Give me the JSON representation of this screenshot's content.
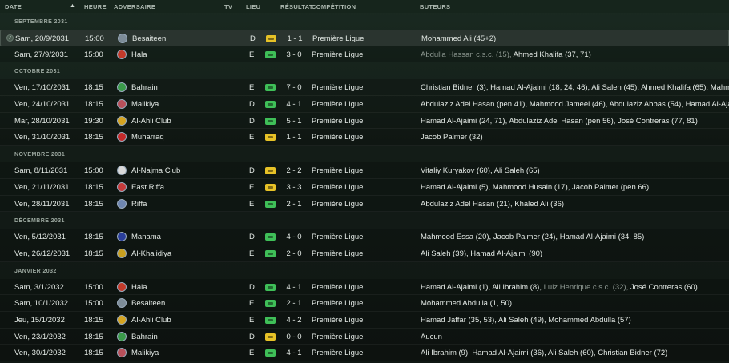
{
  "header": {
    "date": "DATE",
    "time": "HEURE",
    "opponent": "ADVERSAIRE",
    "tv": "TV",
    "venue": "LIEU",
    "result": "RÉSULTAT",
    "competition": "COMPÉTITION",
    "scorers": "BUTEURS"
  },
  "colors": {
    "draw": "#e7c227",
    "win": "#3fbf58"
  },
  "sections": [
    {
      "label": "SEPTEMBRE 2031",
      "matches": [
        {
          "date": "Sam, 20/9/2031",
          "time": "15:00",
          "opponent": "Besaiteen",
          "venue": "D",
          "result_type": "D",
          "score": "1 - 1",
          "competition": "Première Ligue",
          "scorers": [
            {
              "text": "Mohammed Ali (45+2)",
              "muted": false
            }
          ],
          "selected": true
        },
        {
          "date": "Sam, 27/9/2031",
          "time": "15:00",
          "opponent": "Hala",
          "venue": "E",
          "result_type": "V",
          "score": "3 - 0",
          "competition": "Première Ligue",
          "scorers": [
            {
              "text": "Abdulla Hassan c.s.c. (15),",
              "muted": true
            },
            {
              "text": " Ahmed Khalifa (37, 71)",
              "muted": false
            }
          ]
        }
      ]
    },
    {
      "label": "OCTOBRE 2031",
      "matches": [
        {
          "date": "Ven, 17/10/2031",
          "time": "18:15",
          "opponent": "Bahrain",
          "venue": "E",
          "result_type": "V",
          "score": "7 - 0",
          "competition": "Première Ligue",
          "scorers": [
            {
              "text": "Christian Bidner (3), Hamad Al-Ajaimi (18, 24, 46), Ali Saleh (45), Ahmed Khalifa (65), Mahmo",
              "muted": false
            }
          ]
        },
        {
          "date": "Ven, 24/10/2031",
          "time": "18:15",
          "opponent": "Malikiya",
          "venue": "D",
          "result_type": "V",
          "score": "4 - 1",
          "competition": "Première Ligue",
          "scorers": [
            {
              "text": "Abdulaziz Adel Hasan (pen 41), Mahmood Jameel (46), Abdulaziz Abbas (54), Hamad Al-Aja",
              "muted": false
            }
          ]
        },
        {
          "date": "Mar, 28/10/2031",
          "time": "19:30",
          "opponent": "Al-Ahli Club",
          "venue": "D",
          "result_type": "V",
          "score": "5 - 1",
          "competition": "Première Ligue",
          "scorers": [
            {
              "text": "Hamad Al-Ajaimi (24, 71), Abdulaziz Adel Hasan (pen 56), José Contreras (77, 81)",
              "muted": false
            }
          ]
        },
        {
          "date": "Ven, 31/10/2031",
          "time": "18:15",
          "opponent": "Muharraq",
          "venue": "E",
          "result_type": "D",
          "score": "1 - 1",
          "competition": "Première Ligue",
          "scorers": [
            {
              "text": "Jacob Palmer (32)",
              "muted": false
            }
          ]
        }
      ]
    },
    {
      "label": "NOVEMBRE 2031",
      "matches": [
        {
          "date": "Sam, 8/11/2031",
          "time": "15:00",
          "opponent": "Al-Najma Club",
          "venue": "D",
          "result_type": "D",
          "score": "2 - 2",
          "competition": "Première Ligue",
          "scorers": [
            {
              "text": "Vitaliy Kuryakov (60), Ali Saleh (65)",
              "muted": false
            }
          ]
        },
        {
          "date": "Ven, 21/11/2031",
          "time": "18:15",
          "opponent": "East Riffa",
          "venue": "E",
          "result_type": "D",
          "score": "3 - 3",
          "competition": "Première Ligue",
          "scorers": [
            {
              "text": "Hamad Al-Ajaimi (5), Mahmood Husain (17), Jacob Palmer (pen 66)",
              "muted": false
            }
          ]
        },
        {
          "date": "Ven, 28/11/2031",
          "time": "18:15",
          "opponent": "Riffa",
          "venue": "E",
          "result_type": "V",
          "score": "2 - 1",
          "competition": "Première Ligue",
          "scorers": [
            {
              "text": "Abdulaziz Adel Hasan (21), Khaled Ali (36)",
              "muted": false
            }
          ]
        }
      ]
    },
    {
      "label": "DÉCEMBRE 2031",
      "matches": [
        {
          "date": "Ven, 5/12/2031",
          "time": "18:15",
          "opponent": "Manama",
          "venue": "D",
          "result_type": "V",
          "score": "4 - 0",
          "competition": "Première Ligue",
          "scorers": [
            {
              "text": "Mahmood Essa (20), Jacob Palmer (24), Hamad Al-Ajaimi (34, 85)",
              "muted": false
            }
          ]
        },
        {
          "date": "Ven, 26/12/2031",
          "time": "18:15",
          "opponent": "Al-Khalidiya",
          "venue": "E",
          "result_type": "V",
          "score": "2 - 0",
          "competition": "Première Ligue",
          "scorers": [
            {
              "text": "Ali Saleh (39), Hamad Al-Ajaimi (90)",
              "muted": false
            }
          ]
        }
      ]
    },
    {
      "label": "JANVIER 2032",
      "matches": [
        {
          "date": "Sam, 3/1/2032",
          "time": "15:00",
          "opponent": "Hala",
          "venue": "D",
          "result_type": "V",
          "score": "4 - 1",
          "competition": "Première Ligue",
          "scorers": [
            {
              "text": "Hamad Al-Ajaimi (1), Ali Ibrahim (8),",
              "muted": false
            },
            {
              "text": " Luiz Henrique c.s.c. (32),",
              "muted": true
            },
            {
              "text": " José Contreras (60)",
              "muted": false
            }
          ]
        },
        {
          "date": "Sam, 10/1/2032",
          "time": "15:00",
          "opponent": "Besaiteen",
          "venue": "E",
          "result_type": "V",
          "score": "2 - 1",
          "competition": "Première Ligue",
          "scorers": [
            {
              "text": "Mohammed Abdulla (1, 50)",
              "muted": false
            }
          ]
        },
        {
          "date": "Jeu, 15/1/2032",
          "time": "18:15",
          "opponent": "Al-Ahli Club",
          "venue": "E",
          "result_type": "V",
          "score": "4 - 2",
          "competition": "Première Ligue",
          "scorers": [
            {
              "text": "Hamad Jaffar (35, 53), Ali Saleh (49), Mohammed Abdulla (57)",
              "muted": false
            }
          ]
        },
        {
          "date": "Ven, 23/1/2032",
          "time": "18:15",
          "opponent": "Bahrain",
          "venue": "D",
          "result_type": "D",
          "score": "0 - 0",
          "competition": "Première Ligue",
          "scorers": [
            {
              "text": "Aucun",
              "muted": false
            }
          ]
        },
        {
          "date": "Ven, 30/1/2032",
          "time": "18:15",
          "opponent": "Malikiya",
          "venue": "E",
          "result_type": "V",
          "score": "4 - 1",
          "competition": "Première Ligue",
          "scorers": [
            {
              "text": "Ali Ibrahim (9), Hamad Al-Ajaimi (36), Ali Saleh (60), Christian Bidner (72)",
              "muted": false
            }
          ]
        }
      ]
    }
  ]
}
